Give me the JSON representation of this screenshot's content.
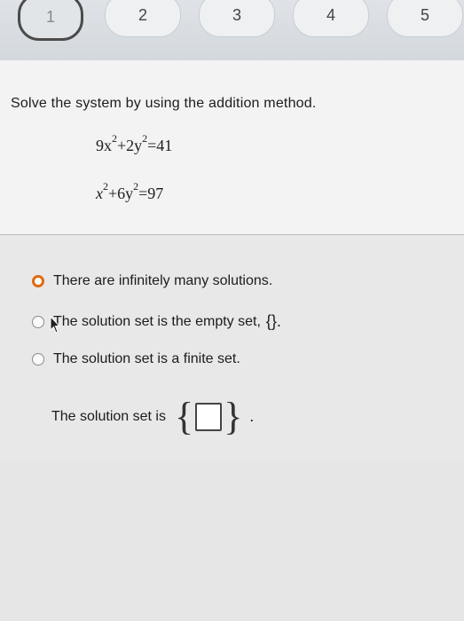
{
  "steps": [
    {
      "label": "1",
      "active": true
    },
    {
      "label": "2"
    },
    {
      "label": "3"
    },
    {
      "label": "4"
    },
    {
      "label": "5"
    }
  ],
  "question": {
    "prompt": "Solve the system by using the addition method.",
    "equation1": {
      "a": "9x",
      "b": "+2y",
      "rhs": "=41",
      "exp": "2"
    },
    "equation2": {
      "a": "x",
      "b": "+6y",
      "rhs": "=97",
      "exp": "2"
    }
  },
  "answer": {
    "options": [
      {
        "text": "There are infinitely many solutions.",
        "selected": true
      },
      {
        "text": "The solution set is the empty set,",
        "suffix": "{}.",
        "selected": false
      },
      {
        "text": "The solution set is a finite set.",
        "selected": false
      }
    ],
    "finite_prompt": "The solution set is",
    "finite_suffix": "."
  },
  "colors": {
    "selected_radio": "#e06a12"
  }
}
